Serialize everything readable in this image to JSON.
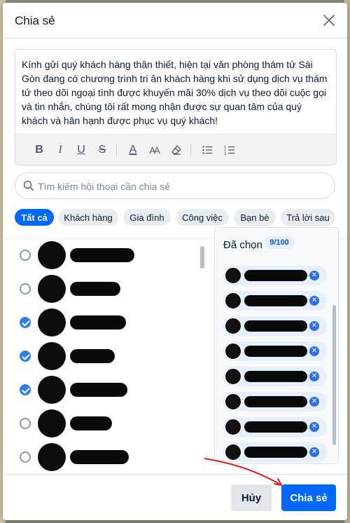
{
  "dialog": {
    "title": "Chia sẻ",
    "message": "Kính gửi quý khách hàng thân thiết, hiện tại văn phòng thám tử Sài Gòn đang có chương trình tri ân khách hàng khi sử dụng dịch vụ thám tử theo dõi ngoại tình được khuyến mãi 30% dịch vụ theo dõi cuộc gọi và tin nhắn, chúng tôi rất mong nhận được sự quan tâm của quý khách và hân hạnh được phục vụ quý khách!"
  },
  "toolbar": {
    "bold": "B",
    "italic": "I",
    "underline": "U",
    "strike": "S",
    "font_color": "A",
    "font_size": "AA",
    "eraser": "eraser-icon",
    "bullet_list": "bullet-list-icon",
    "numbered_list": "numbered-list-icon"
  },
  "search": {
    "placeholder": "Tìm kiếm hội thoại cần chia sẻ"
  },
  "tabs": [
    {
      "label": "Tất cả",
      "active": true
    },
    {
      "label": "Khách hàng"
    },
    {
      "label": "Gia đình"
    },
    {
      "label": "Công việc"
    },
    {
      "label": "Bạn bè"
    },
    {
      "label": "Trả lời sau"
    }
  ],
  "contacts": [
    {
      "checked": false
    },
    {
      "checked": false
    },
    {
      "checked": true
    },
    {
      "checked": true
    },
    {
      "checked": true
    },
    {
      "checked": false
    },
    {
      "checked": false
    }
  ],
  "selected": {
    "title": "Đã chọn",
    "count": "9/100",
    "chips": 9
  },
  "footer": {
    "cancel_label": "Hủy",
    "share_label": "Chia sẻ"
  },
  "colors": {
    "accent": "#0068ff",
    "annotation_arrow": "#e02020"
  }
}
